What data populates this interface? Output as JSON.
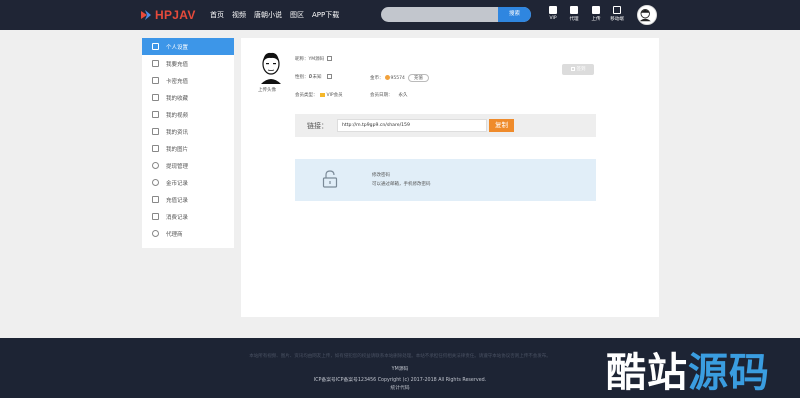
{
  "header": {
    "logo": "HPJAV",
    "nav": [
      "首页",
      "视频",
      "唐朝小说",
      "图区",
      "APP下载"
    ],
    "search": {
      "placeholder": "",
      "button": "搜索"
    },
    "tools": [
      {
        "icon": "vip-icon",
        "label": "VIP"
      },
      {
        "icon": "agent-icon",
        "label": "代理"
      },
      {
        "icon": "upload-icon",
        "label": "上传"
      },
      {
        "icon": "mobile-icon",
        "label": "移动端"
      }
    ]
  },
  "sidebar": {
    "items": [
      {
        "label": "个人设置",
        "icon": "user-icon",
        "active": true
      },
      {
        "label": "我要充值",
        "icon": "wallet-icon"
      },
      {
        "label": "卡密充值",
        "icon": "card-icon"
      },
      {
        "label": "我的收藏",
        "icon": "star-icon"
      },
      {
        "label": "我的视频",
        "icon": "video-icon"
      },
      {
        "label": "我的资讯",
        "icon": "news-icon"
      },
      {
        "label": "我的图片",
        "icon": "image-icon"
      },
      {
        "label": "提现管理",
        "icon": "withdraw-icon"
      },
      {
        "label": "金币记录",
        "icon": "coin-icon"
      },
      {
        "label": "充值记录",
        "icon": "recharge-icon"
      },
      {
        "label": "消费记录",
        "icon": "receipt-icon"
      },
      {
        "label": "代理商",
        "icon": "agent-icon"
      }
    ]
  },
  "profile": {
    "upload_avatar": "上传头像",
    "nickname_label": "昵称：",
    "nickname": "YM源码",
    "gender_label": "性别：",
    "gender": "未知",
    "coins_label": "金币：",
    "coins": "95574",
    "recharge": "充值",
    "member_type_label": "会员类型：",
    "member_type": "VIP会员",
    "member_expiry_label": "会员日期：",
    "member_expiry": "永久",
    "signin": "签到"
  },
  "invite": {
    "label": "链接：",
    "url": "http://m.tp9gp9.cn/share/159",
    "copy": "复制"
  },
  "password": {
    "title": "修改密码",
    "desc": "可以通过邮箱，手机修改密码"
  },
  "footer": {
    "notice": "本站所有视频、图片、资讯均由网友上传，如有侵犯您的权益请联系本站删除处理。本站不承担任何相关法律责任。请遵守本站协议否则上传不会发布。",
    "site": "YM源码",
    "icp": "ICP备案号ICP备案号123456   Copyright (c) 2017-2018 All Rights Reserved.",
    "stats": "统计代码"
  },
  "watermark": {
    "part1": "酷站",
    "part2": "源码"
  },
  "colors": {
    "header": "#1f2535",
    "accent": "#3d96e8",
    "copy_button": "#ef8b2b"
  }
}
